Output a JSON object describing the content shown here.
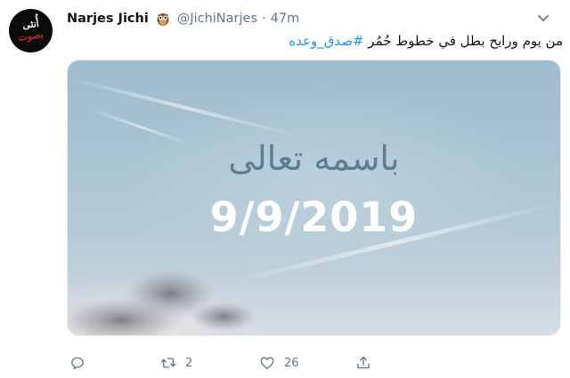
{
  "author": {
    "name": "Narjes Jichi",
    "handle": "@JichiNarjes",
    "separator": "·",
    "time": "47m",
    "badge_icon": "owl-emoji-icon",
    "avatar_text": "أُنثى",
    "avatar_text_2": "بصوت"
  },
  "tweet": {
    "text": "من يوم ورايح بطل في خطوط حُمُر ",
    "hashtag": "#صدق_وعده"
  },
  "media": {
    "line1": "باسمه تعالى",
    "line2": "9/9/2019"
  },
  "actions": {
    "reply_icon": "reply-icon",
    "retweet_icon": "retweet-icon",
    "retweet_count": "2",
    "like_icon": "heart-icon",
    "like_count": "26",
    "share_icon": "share-icon"
  },
  "colors": {
    "link": "#1b95e0",
    "muted": "#657786",
    "text": "#14171a"
  }
}
